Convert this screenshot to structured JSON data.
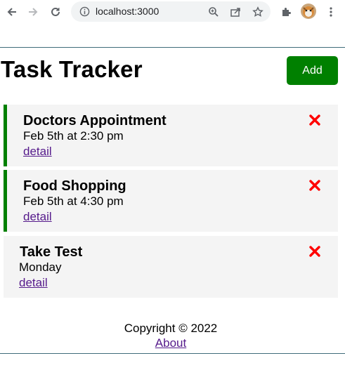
{
  "browser": {
    "url": "localhost:3000"
  },
  "header": {
    "title": "Task Tracker",
    "add_label": "Add"
  },
  "tasks": [
    {
      "text": "Doctors Appointment",
      "day": "Feb 5th at 2:30 pm",
      "link": "detail",
      "reminder": true
    },
    {
      "text": "Food Shopping",
      "day": "Feb 5th at 4:30 pm",
      "link": "detail",
      "reminder": true
    },
    {
      "text": "Take Test",
      "day": "Monday",
      "link": "detail",
      "reminder": false
    }
  ],
  "footer": {
    "copyright": "Copyright © 2022",
    "about": "About"
  },
  "colors": {
    "add_button": "#008000",
    "reminder_border": "#008000",
    "delete_icon": "#ff0000",
    "task_background": "#f4f4f4",
    "link": "#551a8b"
  },
  "icons": [
    "back-arrow-icon",
    "forward-arrow-icon",
    "reload-icon",
    "info-icon",
    "zoom-icon",
    "share-icon",
    "star-icon",
    "extensions-puzzle-icon",
    "profile-avatar",
    "kebab-menu-icon",
    "close-x-icon"
  ]
}
